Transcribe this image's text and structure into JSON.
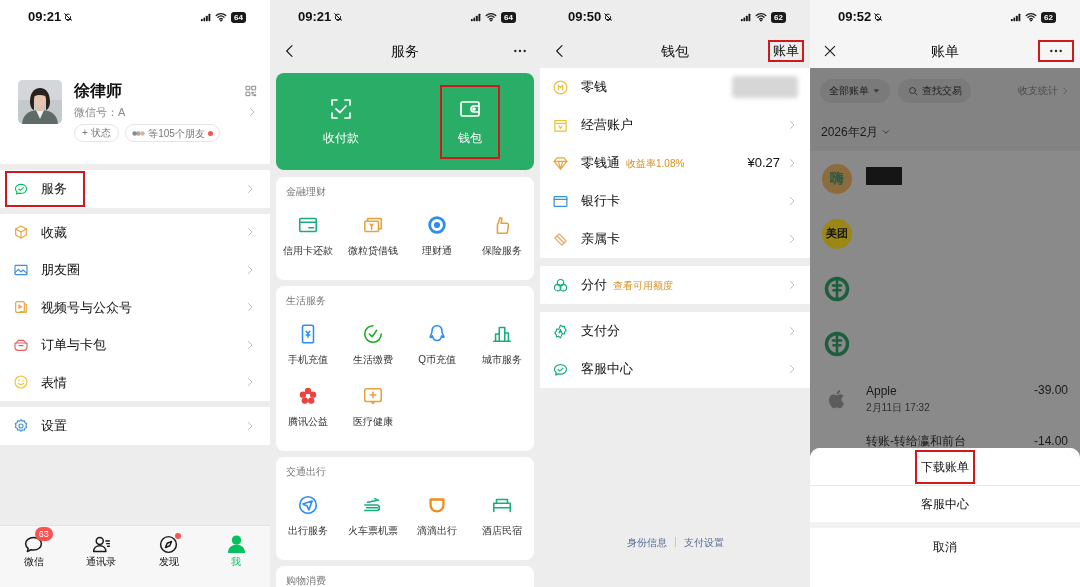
{
  "me_screen": {
    "status_bar": {
      "time": "09:21",
      "battery": "64"
    },
    "profile": {
      "name": "徐律师",
      "wechat_id": "微信号：A",
      "status_button": "+ 状态",
      "friends": "等105个朋友",
      "friends_dot": true
    },
    "menu_groups": [
      {
        "items": [
          {
            "label": "服务",
            "highlighted": true
          }
        ]
      },
      {
        "items": [
          {
            "label": "收藏",
            "highlighted": false
          },
          {
            "label": "朋友圈",
            "highlighted": false
          },
          {
            "label": "视频号与公众号",
            "highlighted": false
          },
          {
            "label": "订单与卡包",
            "highlighted": false
          },
          {
            "label": "表情",
            "highlighted": false
          }
        ]
      },
      {
        "items": [
          {
            "label": "设置",
            "highlighted": false
          }
        ]
      }
    ],
    "tab_bar": [
      {
        "label": "微信",
        "badge": "63",
        "dot": false,
        "selected": false
      },
      {
        "label": "通讯录",
        "dot": false,
        "selected": false
      },
      {
        "label": "发现",
        "dot": true,
        "selected": false
      },
      {
        "label": "我",
        "dot": false,
        "selected": true
      }
    ]
  },
  "services_screen": {
    "status_bar": {
      "time": "09:21",
      "battery": "64"
    },
    "title": "服务",
    "top_actions": [
      {
        "label": "收付款",
        "highlighted": false
      },
      {
        "label": "钱包",
        "highlighted": true
      }
    ],
    "sections": [
      {
        "title": "金融理财",
        "items": [
          {
            "label": "信用卡还款"
          },
          {
            "label": "微粒贷借钱"
          },
          {
            "label": "理财通"
          },
          {
            "label": "保险服务"
          }
        ]
      },
      {
        "title": "生活服务",
        "items": [
          {
            "label": "手机充值"
          },
          {
            "label": "生活缴费"
          },
          {
            "label": "Q币充值"
          },
          {
            "label": "城市服务"
          },
          {
            "label": "腾讯公益"
          },
          {
            "label": "医疗健康"
          }
        ]
      },
      {
        "title": "交通出行",
        "items": [
          {
            "label": "出行服务"
          },
          {
            "label": "火车票机票"
          },
          {
            "label": "滴滴出行"
          },
          {
            "label": "酒店民宿"
          }
        ]
      },
      {
        "title": "购物消费"
      }
    ]
  },
  "wallet_screen": {
    "status_bar": {
      "time": "09:50",
      "battery": "62"
    },
    "title": "钱包",
    "action": {
      "label": "账单",
      "highlighted": true
    },
    "groups": [
      {
        "items": [
          {
            "label": "零钱",
            "value_hidden": true,
            "chevron": false
          },
          {
            "label": "经营账户",
            "value_hidden": false,
            "chevron": true
          },
          {
            "label": "零钱通",
            "tag": "收益率1.08%",
            "value": "¥0.27",
            "value_hidden": false,
            "chevron": true
          },
          {
            "label": "银行卡",
            "value_hidden": false,
            "chevron": true
          },
          {
            "label": "亲属卡",
            "value_hidden": false,
            "chevron": true
          }
        ]
      },
      {
        "items": [
          {
            "label": "分付",
            "tag": "查看可用额度",
            "value_hidden": false,
            "chevron": true
          }
        ]
      },
      {
        "items": [
          {
            "label": "支付分",
            "value_hidden": false,
            "chevron": true
          },
          {
            "label": "客服中心",
            "value_hidden": false,
            "chevron": true
          }
        ]
      }
    ],
    "footer_links": [
      "身份信息",
      "支付设置"
    ]
  },
  "bill_screen": {
    "status_bar": {
      "time": "09:52",
      "battery": "62"
    },
    "title": "账单",
    "more_highlighted": true,
    "filters": [
      {
        "kind": "dropdown",
        "label": "全部账单"
      },
      {
        "kind": "search",
        "label": "查找交易"
      }
    ],
    "stats_link": "收支统计",
    "month": "2026年2月",
    "transactions": [
      {
        "logo_text": "嗨",
        "redacted": true
      },
      {
        "logo_text": "美团",
        "redacted": false
      },
      {
        "redacted": false
      },
      {
        "redacted": false
      },
      {
        "title": "Apple",
        "time": "2月11日 17:32",
        "amount": "-39.00",
        "redacted": false
      },
      {
        "title": "转账-转给瀛和前台",
        "amount": "-14.00",
        "redacted": false
      }
    ],
    "action_sheet": [
      {
        "kind": "option",
        "label": "下载账单",
        "highlighted": true
      },
      {
        "kind": "option",
        "label": "客服中心",
        "highlighted": false
      },
      {
        "kind": "cancel",
        "label": "取消",
        "highlighted": false
      }
    ]
  }
}
